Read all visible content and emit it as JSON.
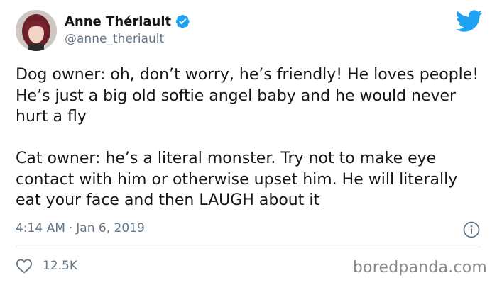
{
  "author": {
    "display_name": "Anne Thériault",
    "handle": "@anne_theriault",
    "verified": true,
    "avatar_icon": "profile-photo"
  },
  "tweet": {
    "paragraphs": [
      "Dog owner: oh, don’t worry, he’s friendly! He loves people! He’s just a big old softie angel baby and he would never hurt a fly",
      "Cat owner: he’s a literal monster. Try not to make eye contact with him or otherwise upset him. He will literally eat your face and then LAUGH about it"
    ],
    "time": "4:14 AM",
    "separator": "·",
    "date": "Jan 6, 2019"
  },
  "stats": {
    "likes": "12.5K"
  },
  "icons": {
    "brand": "twitter-bird-icon",
    "verified": "verified-badge-icon",
    "info": "info-icon",
    "like": "heart-icon"
  },
  "colors": {
    "twitter_blue": "#1da1f2",
    "secondary_text": "#657786",
    "primary_text": "#14171a",
    "divider": "#e1e8ed"
  },
  "watermark": "boredpanda.com"
}
